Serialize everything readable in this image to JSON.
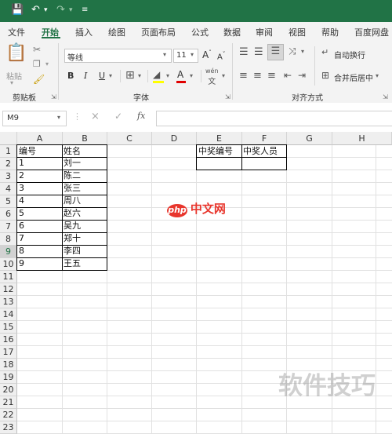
{
  "quick_access": {
    "save_icon": "save-icon",
    "undo_icon": "undo-icon",
    "redo_icon": "redo-icon",
    "customize_icon": "customize-icon"
  },
  "tabs": [
    "文件",
    "开始",
    "插入",
    "绘图",
    "页面布局",
    "公式",
    "数据",
    "审阅",
    "视图",
    "帮助",
    "百度网盘"
  ],
  "active_tab": "开始",
  "ribbon": {
    "clipboard": {
      "paste_label": "粘贴",
      "group_label": "剪贴板"
    },
    "font": {
      "font_name": "等线",
      "font_size": "11",
      "grow": "A",
      "shrink": "A",
      "bold": "B",
      "italic": "I",
      "underline": "U",
      "phonetic": "wén",
      "group_label": "字体"
    },
    "alignment": {
      "wrap_label": "自动换行",
      "merge_label": "合并后居中",
      "group_label": "对齐方式"
    }
  },
  "formula_bar": {
    "name_box": "M9",
    "fx": "fx",
    "cancel": "×",
    "enter": "✓",
    "value": ""
  },
  "columns": [
    "A",
    "B",
    "C",
    "D",
    "E",
    "F",
    "G",
    "H"
  ],
  "rows": [
    "1",
    "2",
    "3",
    "4",
    "5",
    "6",
    "7",
    "8",
    "9",
    "10",
    "11",
    "12",
    "13",
    "14",
    "15",
    "16",
    "17",
    "18",
    "19",
    "20",
    "21",
    "22",
    "23"
  ],
  "selected_row": "9",
  "table_ab": [
    [
      "编号",
      "姓名"
    ],
    [
      "1",
      "刘一"
    ],
    [
      "2",
      "陈二"
    ],
    [
      "3",
      "张三"
    ],
    [
      "4",
      "周八"
    ],
    [
      "5",
      "赵六"
    ],
    [
      "6",
      "吴九"
    ],
    [
      "7",
      "郑十"
    ],
    [
      "8",
      "李四"
    ],
    [
      "9",
      "王五"
    ]
  ],
  "table_ef": [
    [
      "中奖编号",
      "中奖人员"
    ],
    [
      "",
      ""
    ]
  ],
  "watermarks": {
    "php_logo": "php",
    "php_site": "中文网",
    "bottom": "软件技巧"
  }
}
